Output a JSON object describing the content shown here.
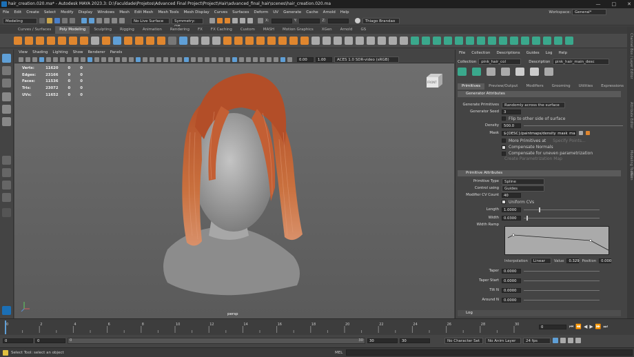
{
  "title": "hair_creation.020.ma* - Autodesk MAYA 2023.3: D:\\Faculdade\\Projetos\\Advanced Final Project\\Project\\Hair\\advanced_final_hair\\scenes\\hair_creation.020.ma",
  "menu": [
    "File",
    "Edit",
    "Create",
    "Select",
    "Modify",
    "Display",
    "Windows",
    "Mesh",
    "Edit Mesh",
    "Mesh Tools",
    "Mesh Display",
    "Curves",
    "Surfaces",
    "Deform",
    "UV",
    "Generate",
    "Cache",
    "Arnold",
    "Help"
  ],
  "workspace_label": "Workspace:",
  "workspace_value": "General*",
  "status": {
    "mode": "Modeling",
    "live": "No Live Surface",
    "symmetry": "Symmetry: Off",
    "user": "Thiago Brandao",
    "x": "X:",
    "y": "Y:",
    "z": "Z:"
  },
  "shelf_tabs": [
    "Curves / Surfaces",
    "Poly Modeling",
    "Sculpting",
    "Rigging",
    "Animation",
    "Rendering",
    "FX",
    "FX Caching",
    "Custom",
    "MASH",
    "Motion Graphics",
    "XGen",
    "Arnold",
    "GS"
  ],
  "vp_menu": [
    "View",
    "Shading",
    "Lighting",
    "Show",
    "Renderer",
    "Panels"
  ],
  "vp_values": {
    "near": "0.00",
    "scale": "1.00",
    "colorspace": "ACES 1.0 SDR-video (sRGB)"
  },
  "hud": [
    [
      "Verts:",
      "11620",
      "0",
      "0"
    ],
    [
      "Edges:",
      "23166",
      "0",
      "0"
    ],
    [
      "Faces:",
      "11536",
      "0",
      "0"
    ],
    [
      "Tris:",
      "23072",
      "0",
      "0"
    ],
    [
      "UVs:",
      "11652",
      "0",
      "0"
    ]
  ],
  "cube_label": "FRONT",
  "camera_label": "persp",
  "xgen": {
    "menu": [
      "File",
      "Collection",
      "Descriptions",
      "Guides",
      "Log",
      "Help"
    ],
    "collection_label": "Collection",
    "collection": "pink_hair_col",
    "description_label": "Description",
    "description": "pink_hair_main_desc",
    "tabs": [
      "Primitives",
      "Preview/Output",
      "Modifiers",
      "Grooming",
      "Utilities",
      "Expressions"
    ],
    "gen_header": "Generator Attributes",
    "gen_prims_label": "Generate Primitives",
    "gen_prims": "Randomly across the surface",
    "seed_label": "Generator Seed",
    "seed": "3",
    "flip": "Flip to other side of surface",
    "density_label": "Density",
    "density": "500.0",
    "mask_label": "Mask",
    "mask": "${DESC}/paintmaps/density_mask_main_hair",
    "more_prims": "More Primitives at",
    "specify": "Specify Points...",
    "comp_normals": "Compensate Normals",
    "comp_uneven": "Compensate for uneven parametrization",
    "create_map": "Create Parametrization Map",
    "prim_header": "Primitive Attributes",
    "ptype_label": "Primitive Type",
    "ptype": "Spline",
    "control_label": "Control using",
    "control": "Guides",
    "cv_label": "Modifier CV Count",
    "cv": "40",
    "uniform": "Uniform CVs",
    "length_label": "Length",
    "length": "1.0000",
    "width_label": "Width",
    "width": "0.0300",
    "ramp_label": "Width Ramp",
    "interp_label": "Interpolation",
    "interp": "Linear",
    "value_label": "Value",
    "value": "0.329",
    "position_label": "Position",
    "position": "0.000",
    "taper_label": "Taper",
    "taper": "0.0000",
    "taper_start_label": "Taper Start",
    "taper_start": "0.0000",
    "tilt_label": "Tilt N",
    "tilt": "0.0000",
    "around_label": "Around N",
    "around": "0.0000",
    "log": "Log"
  },
  "right_side": [
    "Channel Box / Layer Editor",
    "Attribute Editor",
    "Modeling Toolkit",
    "XGen"
  ],
  "timeline": {
    "ticks": [
      "0",
      "2",
      "4",
      "6",
      "8",
      "10",
      "12",
      "14",
      "16",
      "18",
      "20",
      "22",
      "24",
      "26",
      "28",
      "30"
    ],
    "frame": "0"
  },
  "range": {
    "start": "0",
    "start2": "0",
    "slider_start": "0",
    "slider_end": "30",
    "end": "30",
    "end2": "30",
    "charset": "No Character Set",
    "animlayer": "No Anim Layer",
    "fps": "24 fps"
  },
  "cmd": {
    "status": "Select Tool: select an object",
    "mel": "MEL"
  },
  "colors": {
    "accent": "#5f9fd6",
    "orange": "#e0862e",
    "green": "#3aa88c"
  }
}
